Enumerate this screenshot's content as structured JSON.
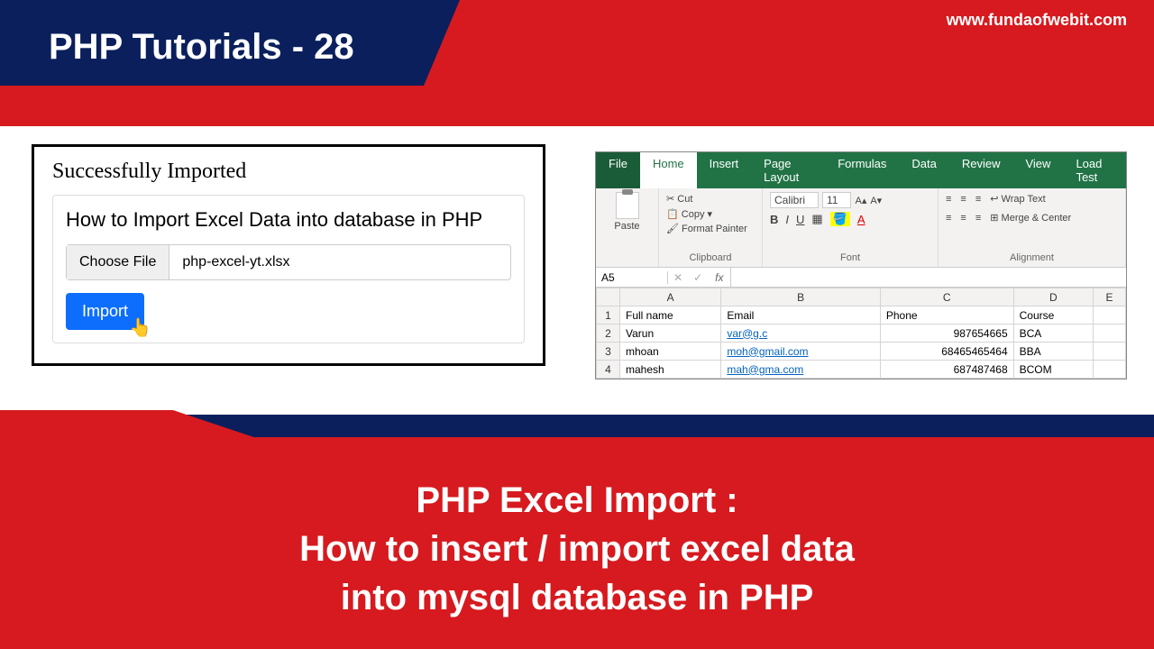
{
  "url": "www.fundaofwebit.com",
  "banner_title": "PHP Tutorials - 28",
  "php": {
    "success": "Successfully Imported",
    "heading": "How to Import Excel Data into database in PHP",
    "choose_label": "Choose File",
    "file_name": "php-excel-yt.xlsx",
    "import_label": "Import"
  },
  "excel": {
    "tabs": [
      "File",
      "Home",
      "Insert",
      "Page Layout",
      "Formulas",
      "Data",
      "Review",
      "View",
      "Load Test"
    ],
    "active_tab": "Home",
    "clipboard": {
      "cut": "Cut",
      "copy": "Copy",
      "fmt": "Format Painter",
      "paste": "Paste",
      "label": "Clipboard"
    },
    "font": {
      "name": "Calibri",
      "size": "11",
      "label": "Font"
    },
    "alignment": {
      "wrap": "Wrap Text",
      "merge": "Merge & Center",
      "label": "Alignment"
    },
    "cell_ref": "A5",
    "fx": "fx",
    "cols": [
      "",
      "A",
      "B",
      "C",
      "D",
      "E"
    ],
    "headers": {
      "a": "Full name",
      "b": "Email",
      "c": "Phone",
      "d": "Course"
    },
    "rows": [
      {
        "n": "2",
        "a": "Varun",
        "b": "var@g.c",
        "c": "987654665",
        "d": "BCA"
      },
      {
        "n": "3",
        "a": "mhoan",
        "b": "moh@gmail.com",
        "c": "68465465464",
        "d": "BBA"
      },
      {
        "n": "4",
        "a": "mahesh",
        "b": "mah@gma.com",
        "c": "687487468",
        "d": "BCOM"
      }
    ]
  },
  "bottom": {
    "l1": "PHP Excel Import :",
    "l2": "How to insert / import excel data",
    "l3": "into mysql database in PHP"
  }
}
